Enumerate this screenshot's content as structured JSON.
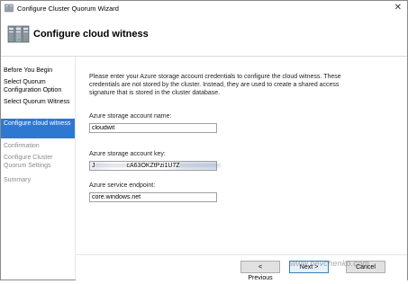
{
  "window": {
    "title": "Configure Cluster Quorum Wizard",
    "close_glyph": "✕",
    "app_icon": "cluster-icon"
  },
  "header": {
    "title": "Configure cloud witness",
    "icon": "cluster-wizard-icon"
  },
  "nav": {
    "items": [
      {
        "label": "Before You Begin",
        "state": "normal"
      },
      {
        "label": "Select Quorum Configuration Option",
        "state": "normal"
      },
      {
        "label": "Select Quorum Witness",
        "state": "normal"
      },
      {
        "label": "Configure cloud witness",
        "state": "selected"
      },
      {
        "label": "Confirmation",
        "state": "disabled"
      },
      {
        "label": "Configure Cluster Quorum Settings",
        "state": "disabled"
      },
      {
        "label": "Summary",
        "state": "disabled"
      }
    ]
  },
  "main": {
    "description": "Please enter your Azure storage account credentials to configure the cloud witness. These credentials are not stored by the cluster. Instead, they are used to create a shared access signature that is stored in the cluster database.",
    "account_name": {
      "label": "Azure storage account name:",
      "value": "cloudwit"
    },
    "account_key": {
      "label": "Azure storage account key:",
      "value_prefix": "J",
      "value_hidden_1": "xxxxxxxxxx",
      "value_visible": "cA63OKZtPzi1U7Z",
      "value_hidden_2": "xxxxxxxxxxxxx"
    },
    "endpoint": {
      "label": "Azure service endpoint:",
      "value": "core.windows.net"
    }
  },
  "footer": {
    "previous_label": "< Previous",
    "next_label": "Next >",
    "cancel_label": "Cancel"
  },
  "watermark": "www.nevchenko.com",
  "colors": {
    "selected_nav": "#2f78d2",
    "disabled_text": "#8a8a8a",
    "default_button_border": "#3c7fb1"
  }
}
